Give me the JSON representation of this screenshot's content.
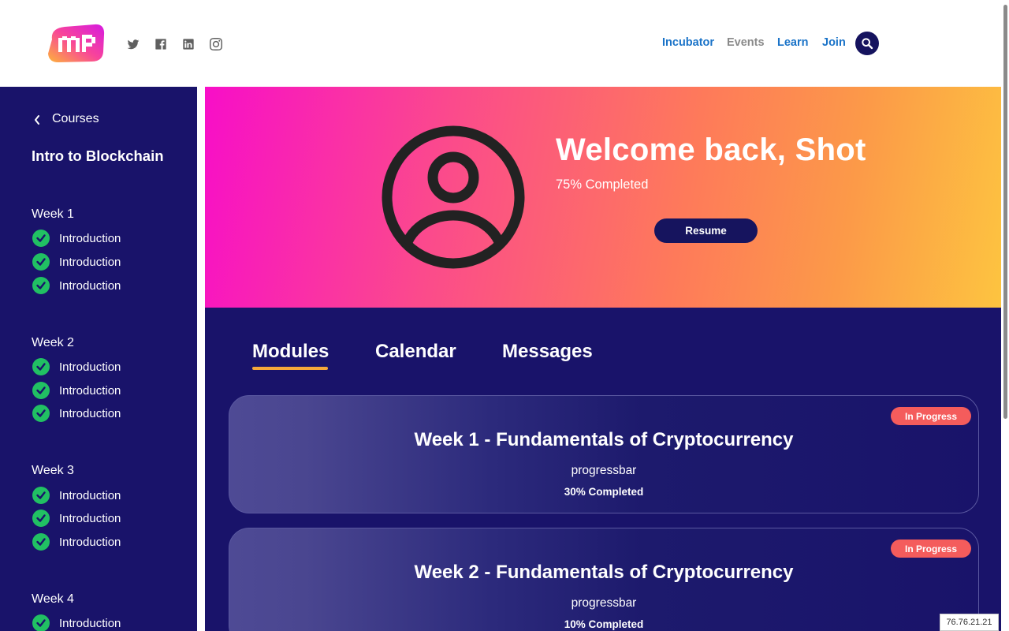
{
  "header": {
    "social_icons": [
      "twitter-icon",
      "facebook-icon",
      "linkedin-icon",
      "instagram-icon"
    ],
    "nav": {
      "incubator": "Incubator",
      "events": "Events",
      "learn": "Learn",
      "join": "Join"
    }
  },
  "sidebar": {
    "back_label": "Courses",
    "course_title": "Intro to Blockchain",
    "weeks": [
      {
        "label": "Week 1",
        "lessons": [
          "Introduction",
          "Introduction",
          "Introduction"
        ]
      },
      {
        "label": "Week 2",
        "lessons": [
          "Introduction",
          "Introduction",
          "Introduction"
        ]
      },
      {
        "label": "Week 3",
        "lessons": [
          "Introduction",
          "Introduction",
          "Introduction"
        ]
      },
      {
        "label": "Week 4",
        "lessons": [
          "Introduction"
        ]
      }
    ]
  },
  "hero": {
    "welcome": "Welcome back, Shot",
    "completed": "75% Completed",
    "resume_label": "Resume"
  },
  "tabs": {
    "modules": "Modules",
    "calendar": "Calendar",
    "messages": "Messages"
  },
  "modules": [
    {
      "title": "Week 1 - Fundamentals of Cryptocurrency",
      "progress_label": "progressbar",
      "completed": "30% Completed",
      "status": "In Progress"
    },
    {
      "title": "Week 2 - Fundamentals of Cryptocurrency",
      "progress_label": "progressbar",
      "completed": "10% Completed",
      "status": "In Progress"
    }
  ],
  "ip_address": "76.76.21.21",
  "colors": {
    "sidebar_bg": "#19136a",
    "nav_blue": "#1a73c8",
    "check_green": "#21c063",
    "badge_red": "#f45c5c",
    "tab_underline": "#f5a83a"
  }
}
